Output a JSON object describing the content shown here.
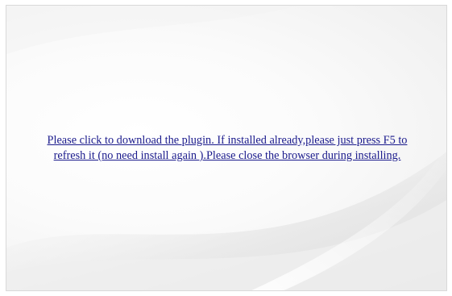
{
  "plugin_prompt": {
    "line1": "Please click to download the plugin. If installed already,please just press F5 to",
    "line2": "refresh it (no need install again ).Please close the browser during installing."
  }
}
